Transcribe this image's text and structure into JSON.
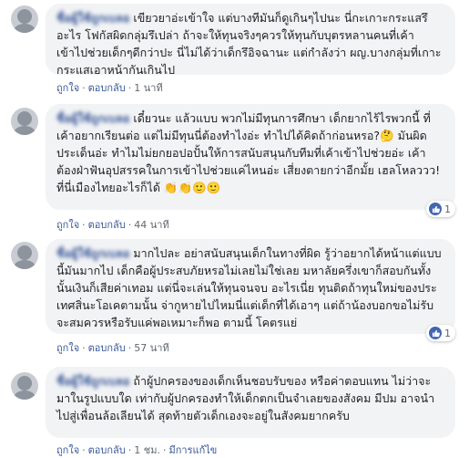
{
  "comments": [
    {
      "author": "ชื่อผู้ใช้ถูกเบลอ",
      "text": "เขียวยาอ่ะเข้าใจ แต่บางทีมันก็ดูเกินๆไปนะ นี่กะเกาะกระแสรึอะไร โฟกัสผิดกลุ่มรึเปล่า ถ้าจะให้ทุนจริงๆควรให้ทุนกับบุตรหลานคนที่เค้าเข้าไปช่วยเด็กๆดีกว่าปะ นี่ไม่ได้ว่าเด็กรึอิจฉานะ แต่กำลังว่า ผญ.บางกลุ่มที่เกาะกระแสเอาหน้ากันเกินไป",
      "actions": {
        "like": "ถูกใจ",
        "reply": "ตอบกลับ",
        "time": "1 นาที"
      },
      "reaction_count": ""
    },
    {
      "author": "ชื่อผู้ใช้ถูกเบลอ",
      "text": "เดี๋ยวนะ แล้วแบบ พวกไม่มีทุนการศึกษา เด็กยากไร้ไรพวกนี้ ที่เค้าอยากเรียนต่อ แต่ไม่มีทุนนี่ต้องทำไงอ่ะ ทำไปได้คิดถ้าก่อนหรอ?🤔 มันผิดประเด็นอ่ะ ทำไมไม่ยกยอปอปั้นให้การสนับสนุนกับทีมที่เค้าเข้าไปช่วยอ่ะ เค้าต้องฝ่าฟันอุปสรรคในการเข้าไปช่วยแค่ไหนอ่ะ เสี่ยงตายกว่าอีกมั้ย เฮลโหลววว! ที่นี่เมืองไทยอะไรก็ได้ 👏👏🙂🙂",
      "actions": {
        "like": "ถูกใจ",
        "reply": "ตอบกลับ",
        "time": "44 นาที"
      },
      "reaction_count": "1"
    },
    {
      "author": "ชื่อผู้ใช้ถูกเบลอ",
      "text": "มากไปละ อย่าสนับสนุนเด็กในทางที่ผิด รู้ว่าอยากได้หน้าแต่แบบนี้มันมากไป เด็กคือผู้ประสบภัยหรอไม่เลยไม่ใช่เลย มหาลัยครึ่งเขาก็สอบกันทั้งนั้นเงินก็เสียค่าเทอม แต่นี่จะเล่นให้ทุนจนจบ อะไรเนี่ย ทุนติดถ้าทุนใหม่ของประเทศสิ่นะโอเคตามนั้น จ่ากูหายไปไหมนี่แต่เด็กที่ได้เอาๆ แต่ถ้าน้องบอกขอไม่รับจะสมควรหรือรับแค่พอเหมาะก็พอ ตามนี้ โคตรแย่",
      "actions": {
        "like": "ถูกใจ",
        "reply": "ตอบกลับ",
        "time": "57 นาที"
      },
      "reaction_count": "1"
    },
    {
      "author": "ชื่อผู้ใช้ถูกเบลอ",
      "text": "ถ้าผู้ปกครองของเด็กเห็นชอบรับของ หรือค่าตอบแทน ไม่ว่าจะมาในรูปแบบใด เท่ากับผู้ปกครองทำให้เด็กตกเป็นจำเลยของสังคม มีปม อาจนำไปสู่เพื่อนล้อเลียนได้ สุดท้ายตัวเด็กเองจะอยู่ในสังคมยากครับ",
      "actions": {
        "like": "ถูกใจ",
        "reply": "ตอบกลับ",
        "time": "1 ชม.",
        "edited": "มีการแก้ไข"
      },
      "reaction_count": ""
    }
  ]
}
